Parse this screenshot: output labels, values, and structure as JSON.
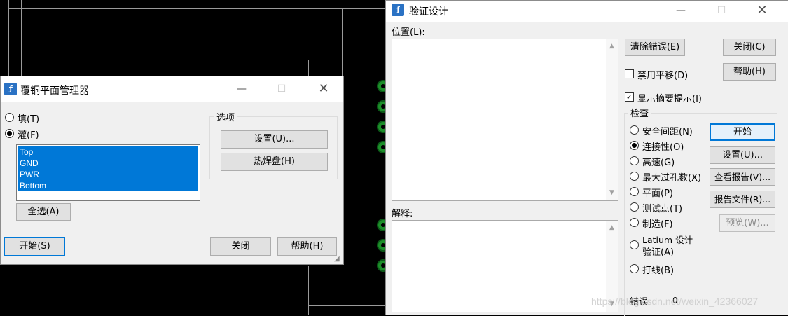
{
  "copper_manager": {
    "title": "覆铜平面管理器",
    "radio_fill": "填(T)",
    "radio_flood": "灌(F)",
    "layers": [
      "Top",
      "GND",
      "PWR",
      "Bottom"
    ],
    "select_all": "全选(A)",
    "options_group": "选项",
    "settings": "设置(U)...",
    "thermal": "热焊盘(H)",
    "start": "开始(S)",
    "close": "关闭",
    "help": "帮助(H)",
    "selected_mode": "flood"
  },
  "verify_design": {
    "title": "验证设计",
    "location_label": "位置(L):",
    "explain_label": "解释:",
    "clear_errors": "清除错误(E)",
    "close": "关闭(C)",
    "disable_pan": "禁用平移(D)",
    "help": "帮助(H)",
    "show_summary": "显示摘要提示(I)",
    "check_group": "检查",
    "checks": [
      "安全间距(N)",
      "连接性(O)",
      "高速(G)",
      "最大过孔数(X)",
      "平面(P)",
      "测试点(T)",
      "制造(F)",
      "Latium 设计",
      "验证(A)",
      "打线(B)"
    ],
    "selected_check": "连接性(O)",
    "start": "开始",
    "settings": "设置(U)...",
    "view_report": "查看报告(V)...",
    "report_file": "报告文件(R)...",
    "preview": "预览(W)...",
    "errors_label": "错误",
    "errors_count": "0"
  },
  "watermark": "https://blog.csdn.net/weixin_42366027",
  "colors": {
    "selection": "#0078d7",
    "pad_green": "#1d8f2a",
    "app_icon": "#2a72c4"
  },
  "icons": [
    "app-icon",
    "minimize-icon",
    "maximize-icon",
    "close-icon",
    "scroll-up-arrow-icon",
    "scroll-down-arrow-icon",
    "resize-grip-icon"
  ]
}
